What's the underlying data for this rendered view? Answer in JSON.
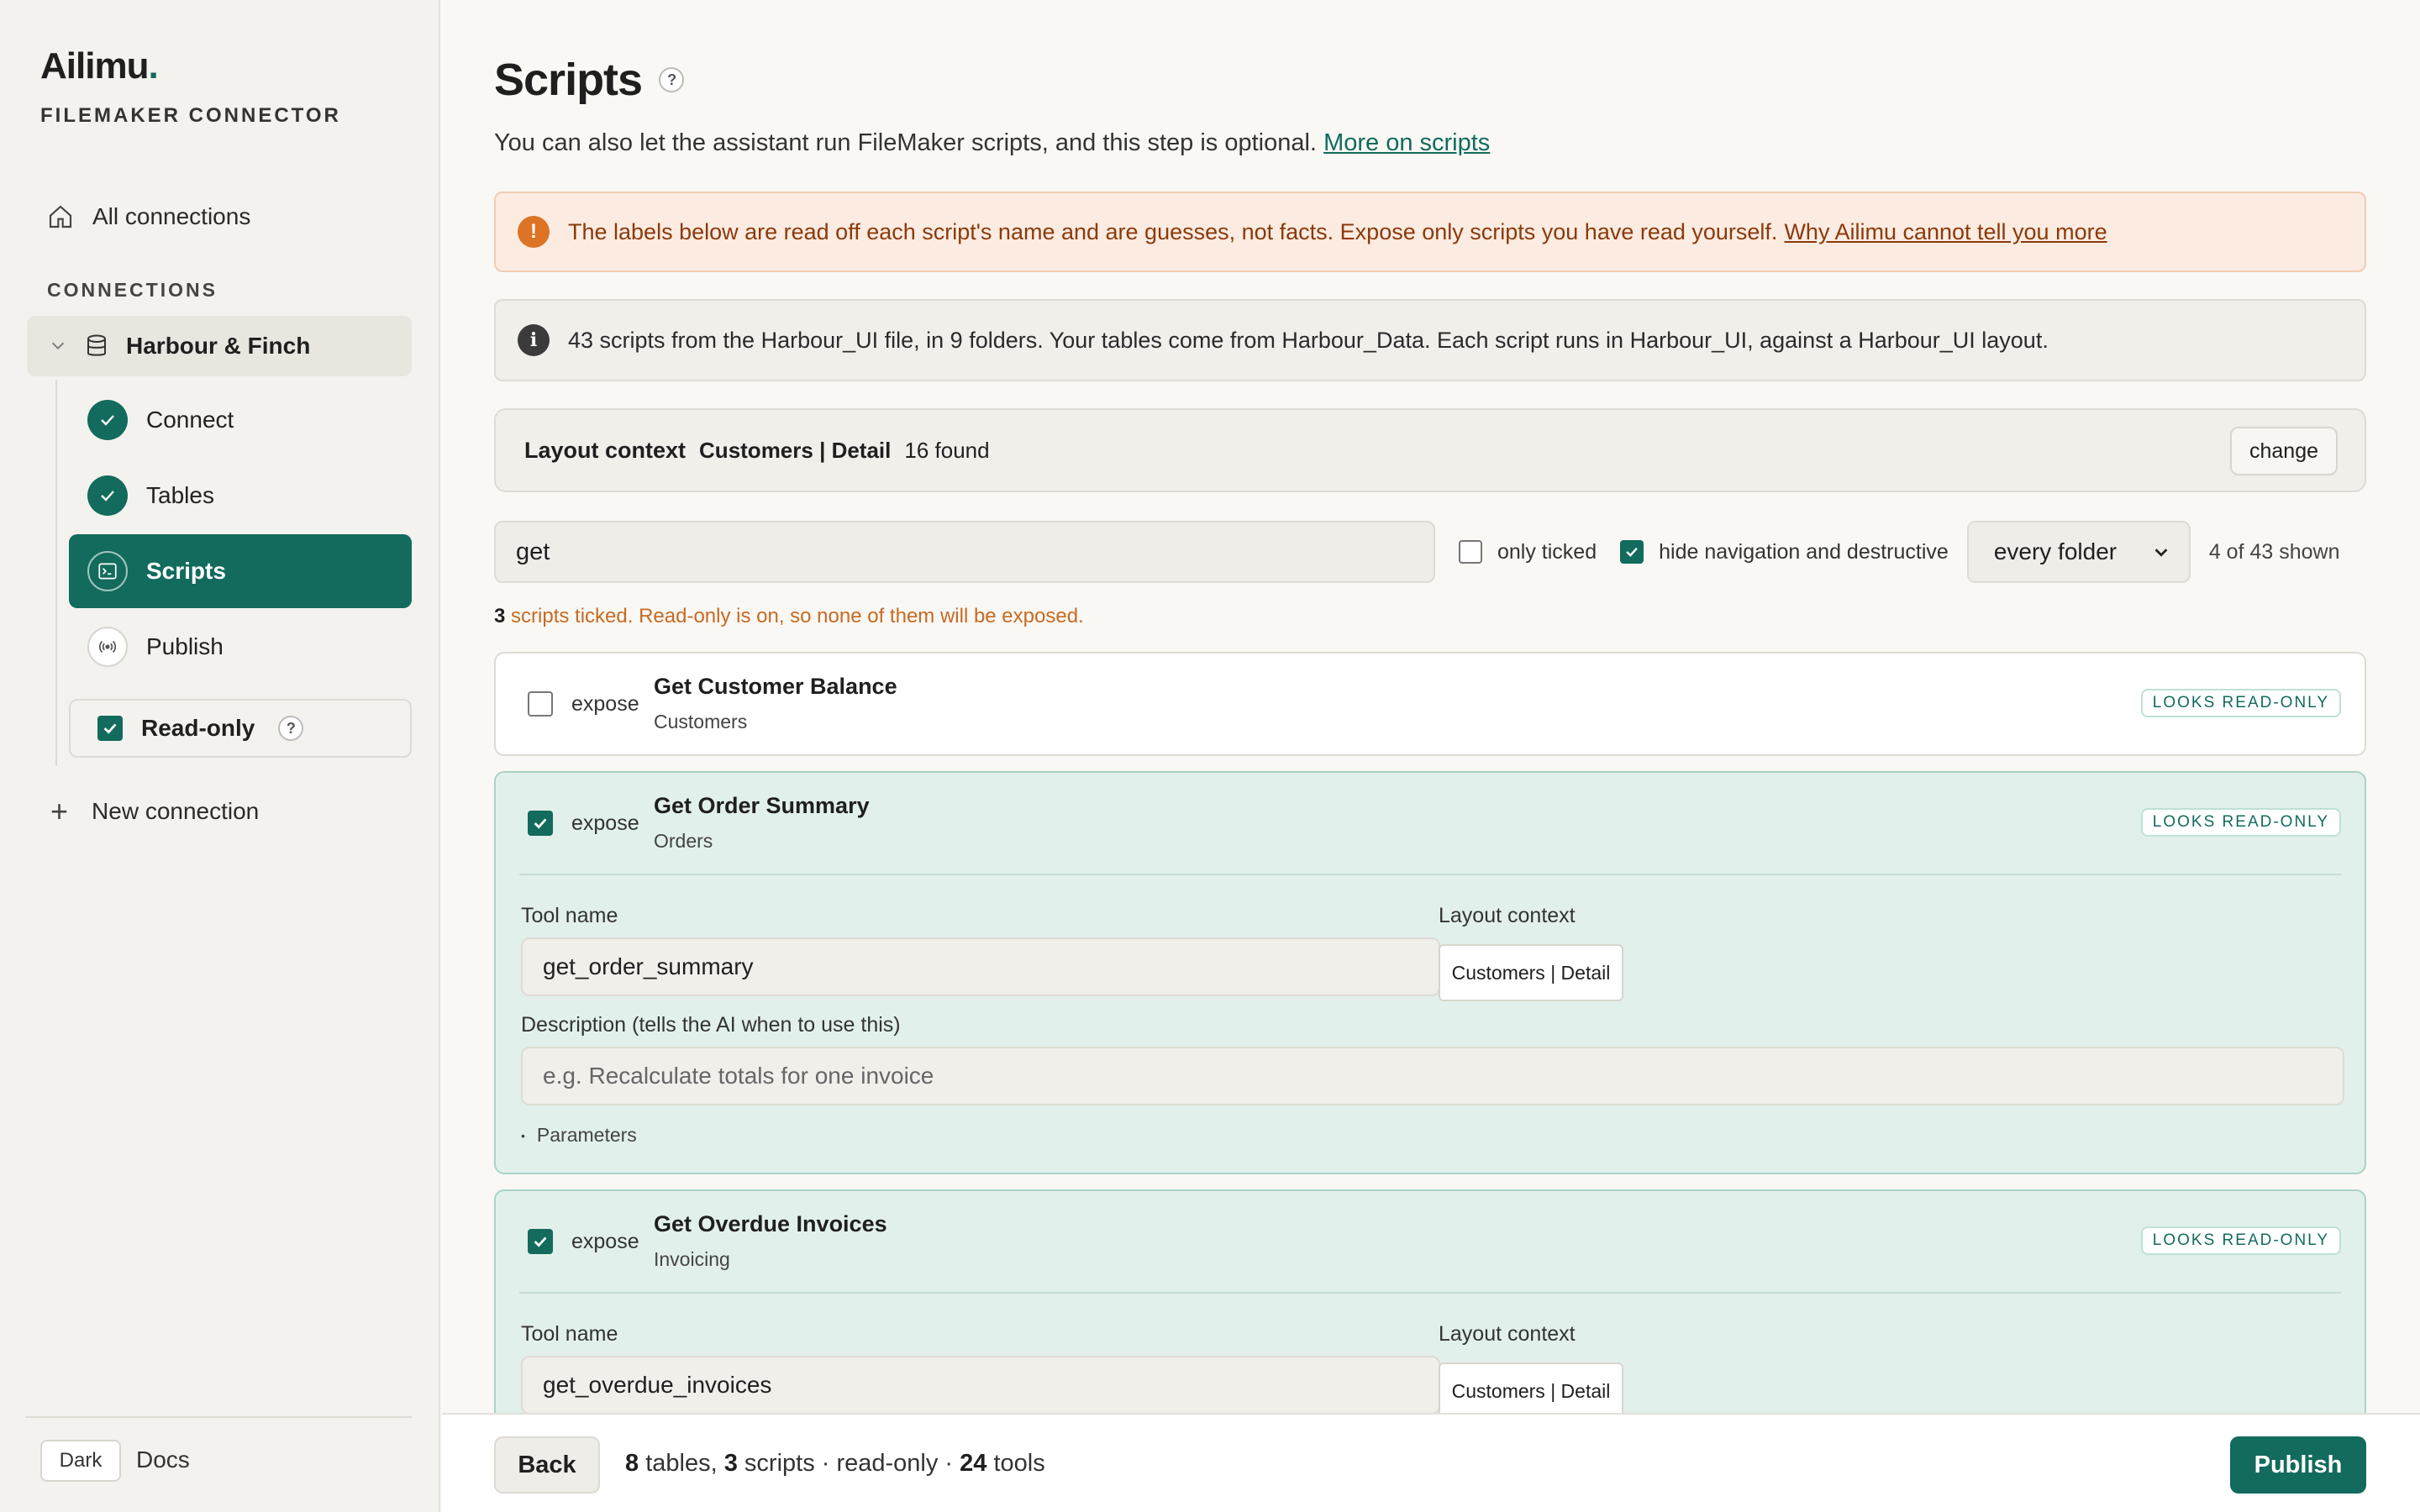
{
  "brand": {
    "name": "Ailimu",
    "dot": ".",
    "subtitle": "FILEMAKER CONNECTOR"
  },
  "sidebar": {
    "all_connections": "All connections",
    "section_heading": "CONNECTIONS",
    "connection_name": "Harbour & Finch",
    "steps": [
      {
        "label": "Connect",
        "state": "done"
      },
      {
        "label": "Tables",
        "state": "done"
      },
      {
        "label": "Scripts",
        "state": "active"
      },
      {
        "label": "Publish",
        "state": "todo"
      }
    ],
    "read_only_label": "Read-only",
    "read_only_help": "?",
    "read_only_checked": true,
    "new_connection": "New connection",
    "theme_button": "Dark",
    "docs_link": "Docs"
  },
  "page": {
    "title": "Scripts",
    "title_help": "?",
    "lead": "You can also let the assistant run FileMaker scripts, and this step is optional.",
    "lead_link": "More on scripts"
  },
  "warning": {
    "icon": "!",
    "text": "The labels below are read off each script's name and are guesses, not facts. Expose only scripts you have read yourself.",
    "link": "Why Ailimu cannot tell you more"
  },
  "info": {
    "icon": "i",
    "text": "43 scripts from the Harbour_UI file, in 9 folders. Your tables come from Harbour_Data. Each script runs in Harbour_UI, against a Harbour_UI layout."
  },
  "layout_context": {
    "label": "Layout context",
    "value": "Customers | Detail",
    "found": "16 found",
    "change": "change"
  },
  "filters": {
    "search_value": "get",
    "only_ticked_label": "only ticked",
    "only_ticked_checked": false,
    "hide_label": "hide navigation and destructive",
    "hide_checked": true,
    "folder_select": "every folder",
    "shown": "4 of 43 shown"
  },
  "status": {
    "count": "3",
    "text": "scripts ticked. Read-only is on, so none of them will be exposed."
  },
  "scripts": [
    {
      "expose_label": "expose",
      "checked": false,
      "name": "Get Customer Balance",
      "folder": "Customers",
      "badge": "LOOKS READ-ONLY"
    },
    {
      "expose_label": "expose",
      "checked": true,
      "name": "Get Order Summary",
      "folder": "Orders",
      "badge": "LOOKS READ-ONLY",
      "tool_name_label": "Tool name",
      "tool_name": "get_order_summary",
      "layout_label": "Layout context",
      "layout_value": "Customers | Detail",
      "desc_label": "Description (tells the AI when to use this)",
      "desc_placeholder": "e.g. Recalculate totals for one invoice",
      "params_label": "Parameters"
    },
    {
      "expose_label": "expose",
      "checked": true,
      "name": "Get Overdue Invoices",
      "folder": "Invoicing",
      "badge": "LOOKS READ-ONLY",
      "tool_name_label": "Tool name",
      "tool_name": "get_overdue_invoices",
      "layout_label": "Layout context",
      "layout_value": "Customers | Detail"
    }
  ],
  "footer": {
    "back": "Back",
    "tables_count": "8",
    "tables_label": "tables,",
    "scripts_count": "3",
    "scripts_label": "scripts · read-only ·",
    "tools_count": "24",
    "tools_label": "tools",
    "publish": "Publish"
  },
  "colors": {
    "accent": "#126b5c",
    "warning_bg": "#fcebe0",
    "warning_text": "#8a3a0c",
    "status_orange": "#c76a21",
    "selected_card": "#e2f0ec"
  },
  "icons": {
    "home": "home-icon",
    "database": "database-icon",
    "check": "check-icon",
    "terminal": "terminal-icon",
    "broadcast": "broadcast-icon",
    "plus": "plus-icon",
    "chevron": "chevron-down-icon"
  }
}
